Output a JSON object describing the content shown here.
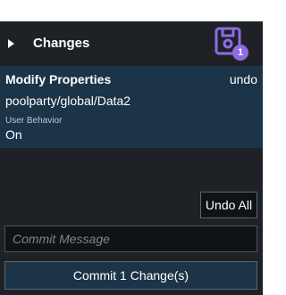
{
  "header": {
    "title": "Changes",
    "caret_icon": "caret-right-icon",
    "save_icon": "save-icon",
    "change_count_badge": "1"
  },
  "change": {
    "title": "Modify Properties",
    "undo_label": "undo",
    "path": "poolparty/global/Data2",
    "property_label": "User Behavior",
    "property_value": "On"
  },
  "actions": {
    "undo_all_label": "Undo All",
    "commit_message_placeholder": "Commit Message",
    "commit_message_value": "",
    "commit_button_label": "Commit 1 Change(s)"
  },
  "colors": {
    "panel_background": "#1e2226",
    "item_background": "#1b3448",
    "accent_purple": "#8e6be3"
  }
}
